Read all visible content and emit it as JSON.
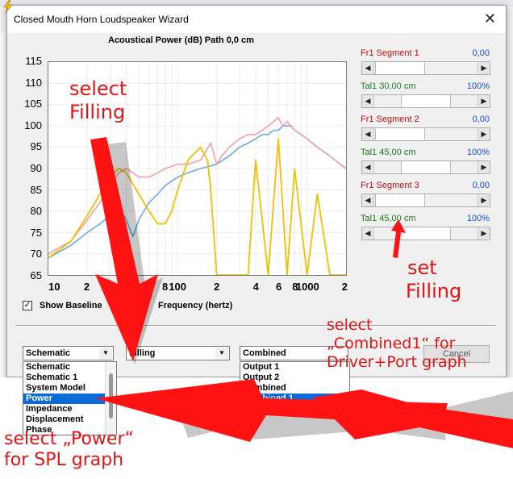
{
  "dialog": {
    "title": "Closed Mouth Horn Loudspeaker Wizard",
    "close_glyph": "✕"
  },
  "chart": {
    "title": "Acoustical Power (dB)   Path 0,0 cm",
    "y_ticks": [
      "115",
      "110",
      "105",
      "100",
      "95",
      "90",
      "85",
      "80",
      "75",
      "70",
      "65"
    ],
    "x_ticks": [
      "10",
      "2",
      "4",
      "6",
      "8",
      "100",
      "2",
      "4",
      "6",
      "8",
      "1000",
      "2"
    ],
    "x_axis_label": "Frequency (hertz)",
    "show_baseline_label": "Show Baseline",
    "show_baseline_checked": true
  },
  "chart_data": {
    "type": "line",
    "title": "Acoustical Power (dB)   Path 0,0 cm",
    "xlabel": "Frequency (hertz)",
    "ylabel": "",
    "ylim": [
      65,
      115
    ],
    "xlim": [
      10,
      2000
    ],
    "xscale": "log",
    "grid": true,
    "series": [
      {
        "color": "#6aaae6",
        "x": [
          10,
          15,
          20,
          25,
          30,
          35,
          40,
          45,
          50,
          60,
          70,
          80,
          100,
          120,
          150,
          200,
          250,
          300,
          350,
          400,
          450,
          500,
          550,
          600,
          650,
          700,
          750,
          800,
          900,
          1000,
          1200,
          1500,
          1800,
          2000
        ],
        "y": [
          69,
          72,
          75,
          77,
          79,
          81,
          78,
          74,
          78,
          82,
          84,
          86,
          88,
          89,
          90,
          91,
          93,
          95,
          96,
          97,
          98,
          98,
          99,
          99,
          100,
          100,
          100,
          99,
          98,
          97,
          95,
          93,
          91,
          90
        ]
      },
      {
        "color": "#f0a0a8",
        "x": [
          10,
          15,
          20,
          25,
          30,
          35,
          40,
          45,
          50,
          60,
          70,
          80,
          100,
          120,
          150,
          180,
          200,
          220,
          250,
          300,
          350,
          400,
          450,
          500,
          550,
          600,
          650,
          700,
          750,
          800,
          900,
          1000,
          1200,
          1500,
          1800,
          2000
        ],
        "y": [
          70,
          73,
          78,
          82,
          86,
          89,
          90,
          89,
          88,
          88,
          89,
          90,
          91,
          91,
          92,
          96,
          91,
          93,
          95,
          97,
          98,
          98,
          99,
          100,
          101,
          102,
          100,
          101,
          100,
          99,
          98,
          97,
          95,
          93,
          91,
          90
        ]
      },
      {
        "color": "#f2c000",
        "x": [
          10,
          15,
          20,
          25,
          30,
          35,
          40,
          50,
          60,
          70,
          80,
          90,
          100,
          120,
          150,
          170,
          180,
          200,
          250,
          300,
          350,
          400,
          500,
          600,
          700,
          800,
          1000,
          1200,
          1500,
          2000
        ],
        "y": [
          69,
          73,
          79,
          84,
          88,
          90,
          89,
          84,
          80,
          77,
          77,
          80,
          85,
          92,
          95,
          92,
          85,
          65,
          65,
          65,
          65,
          92,
          65,
          97,
          65,
          90,
          65,
          84,
          65,
          65
        ]
      }
    ]
  },
  "sliders": [
    {
      "label": "Fr1   Segment 1",
      "value": "0,00",
      "color": "red",
      "thumb": 0.0
    },
    {
      "label": "Tal1   30,00 cm",
      "value": "100%",
      "color": "green",
      "thumb": 0.5
    },
    {
      "label": "Fr1   Segment 2",
      "value": "0,00",
      "color": "red",
      "thumb": 0.0
    },
    {
      "label": "Tal1   45,00 cm",
      "value": "100%",
      "color": "green",
      "thumb": 0.5
    },
    {
      "label": "Fr1   Segment 3",
      "value": "0,00",
      "color": "red",
      "thumb": 0.0
    },
    {
      "label": "Tal1   45,00 cm",
      "value": "100%",
      "color": "green",
      "thumb": 0.5
    }
  ],
  "combos": {
    "schematic_value": "Schematic",
    "filling_value": "Filling",
    "combined_value": "Combined",
    "cancel_label": "Cancel"
  },
  "schematic_list": [
    "Schematic",
    "Schematic 1",
    "System Model",
    "Power",
    "Impedance",
    "Displacement",
    "Phase"
  ],
  "schematic_selected": "Power",
  "output_list": [
    "Output 1",
    "Output 2",
    "Combined",
    "Combined 1"
  ],
  "output_selected": "Combined 1",
  "annotations": {
    "select_filling": [
      "select",
      "Filling"
    ],
    "set_filling": [
      "set",
      "Filling"
    ],
    "select_combined": [
      "select",
      "„Combined1“ for",
      "Driver+Port graph"
    ],
    "select_power": [
      "select „Power“",
      "for SPL graph"
    ],
    "red": "#e01414"
  }
}
